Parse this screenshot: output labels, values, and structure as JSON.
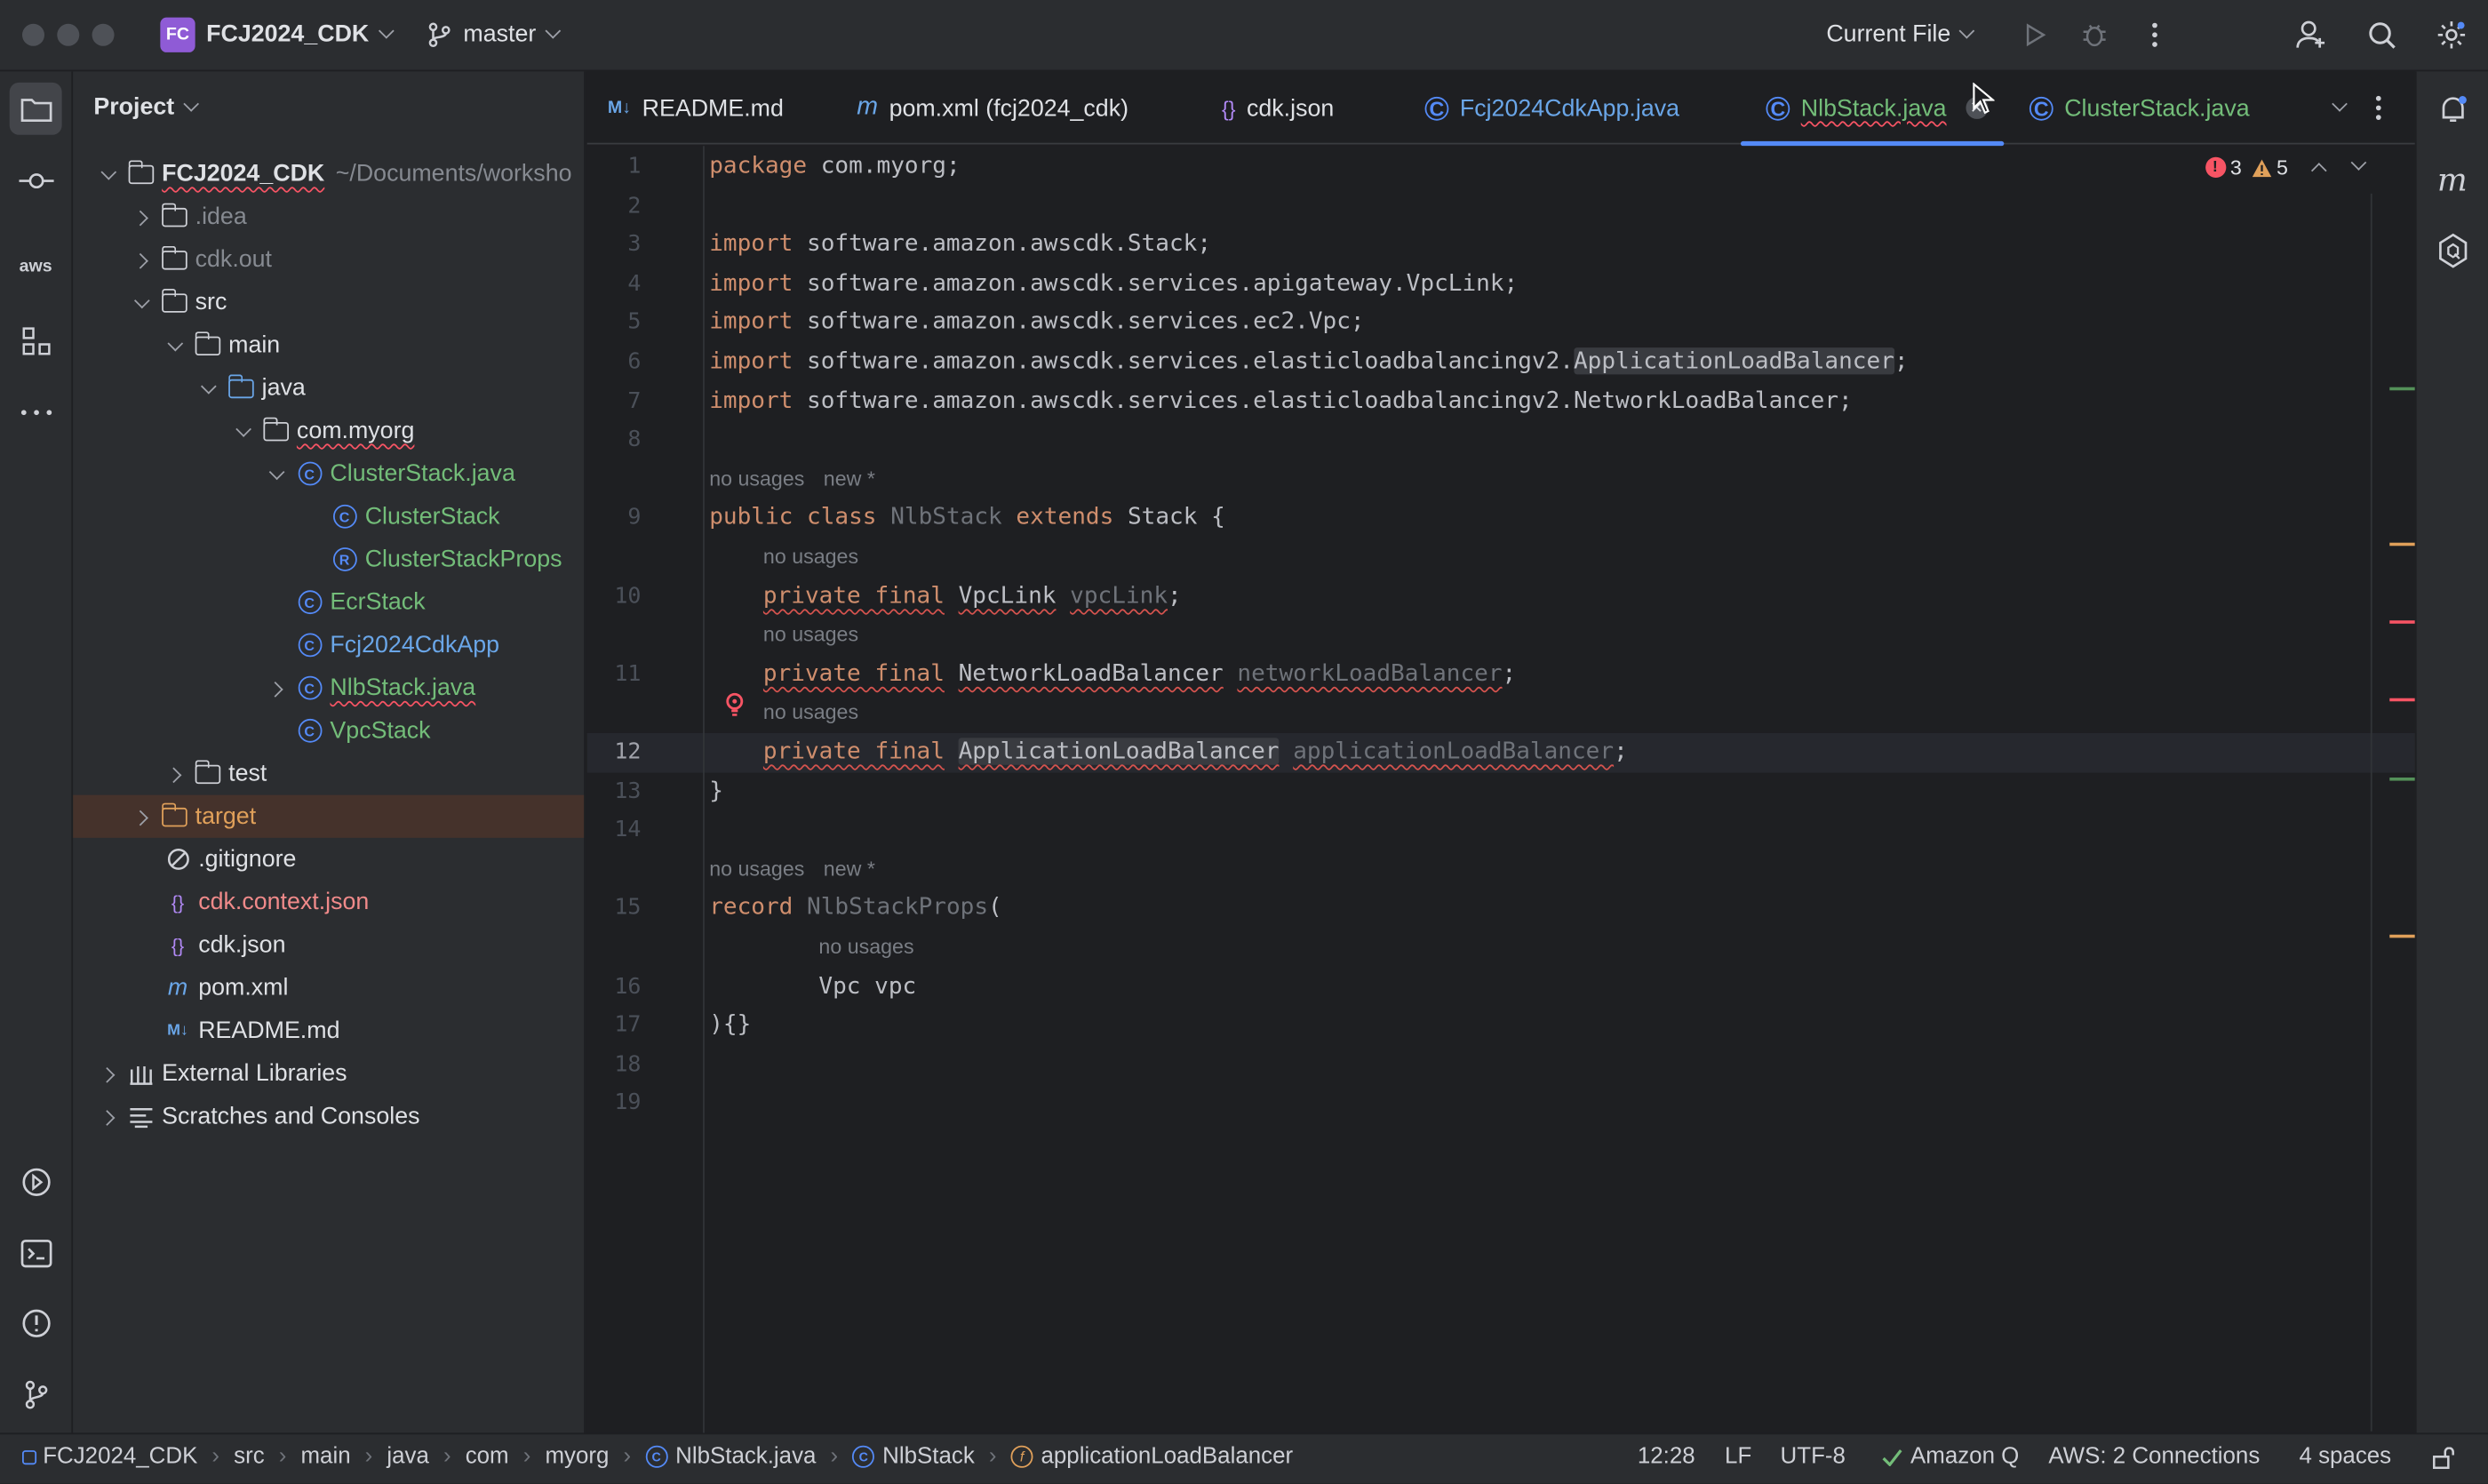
{
  "titlebar": {
    "project_badge": "FC",
    "project_name": "FCJ2024_CDK",
    "branch": "master",
    "run_config": "Current File"
  },
  "project_panel": {
    "header": "Project",
    "root_name": "FCJ2024_CDK",
    "root_path": "~/Documents/worksho",
    "items": [
      {
        "label": ".idea"
      },
      {
        "label": "cdk.out"
      },
      {
        "label": "src"
      },
      {
        "label": "main"
      },
      {
        "label": "java"
      },
      {
        "label": "com.myorg"
      },
      {
        "label": "ClusterStack.java"
      },
      {
        "label": "ClusterStack"
      },
      {
        "label": "ClusterStackProps"
      },
      {
        "label": "EcrStack"
      },
      {
        "label": "Fcj2024CdkApp"
      },
      {
        "label": "NlbStack.java"
      },
      {
        "label": "VpcStack"
      },
      {
        "label": "test"
      },
      {
        "label": "target"
      },
      {
        "label": ".gitignore"
      },
      {
        "label": "cdk.context.json"
      },
      {
        "label": "cdk.json"
      },
      {
        "label": "pom.xml"
      },
      {
        "label": "README.md"
      },
      {
        "label": "External Libraries"
      },
      {
        "label": "Scratches and Consoles"
      }
    ],
    "icon_letters": {
      "class": "C",
      "record": "R",
      "maven": "m",
      "markdown": "M↓"
    }
  },
  "tabs": [
    {
      "label": "README.md",
      "icon": "M↓"
    },
    {
      "label": "pom.xml (fcj2024_cdk)",
      "icon": "m"
    },
    {
      "label": "cdk.json",
      "icon": "{}"
    },
    {
      "label": "Fcj2024CdkApp.java",
      "icon": "C"
    },
    {
      "label": "NlbStack.java",
      "icon": "C"
    },
    {
      "label": "ClusterStack.java",
      "icon": "C"
    }
  ],
  "editor": {
    "line_numbers": [
      "1",
      "2",
      "3",
      "4",
      "5",
      "6",
      "7",
      "8",
      "9",
      "10",
      "11",
      "12",
      "13",
      "14",
      "15",
      "16",
      "17",
      "18",
      "19"
    ],
    "hints": {
      "no_usages": "no usages",
      "new": "new *"
    },
    "errors": "3",
    "warnings": "5",
    "code": {
      "l1_kw": "package",
      "l1": " com.myorg;",
      "l3_kw": "import",
      "l3": " software.amazon.awscdk.Stack;",
      "l4": " software.amazon.awscdk.services.apigateway.VpcLink;",
      "l5": " software.amazon.awscdk.services.ec2.Vpc;",
      "l6": " software.amazon.awscdk.services.elasticloadbalancingv2.",
      "l6_hl": "ApplicationLoadBalancer",
      "l6_end": ";",
      "l7": " software.amazon.awscdk.services.elasticloadbalancingv2.NetworkLoadBalancer;",
      "l9_kw1": "public class",
      "l9_name": "NlbStack",
      "l9_kw2": "extends",
      "l9_rest": " Stack {",
      "private_final": "private final",
      "l10_type": "VpcLink",
      "l10_field": "vpcLink",
      "l11_type": "NetworkLoadBalancer",
      "l11_field": "networkLoadBalancer",
      "l12_type": "ApplicationLoadBalancer",
      "l12_field": "applicationLoadBalancer",
      "semi": ";",
      "l13": "}",
      "l15_kw": "record",
      "l15_name": "NlbStackProps",
      "l15_paren": "(",
      "l16": "Vpc vpc",
      "l17": "){}"
    }
  },
  "statusbar": {
    "crumbs": [
      "FCJ2024_CDK",
      "src",
      "main",
      "java",
      "com",
      "myorg",
      "NlbStack.java",
      "NlbStack",
      "applicationLoadBalancer"
    ],
    "position": "12:28",
    "line_sep": "LF",
    "encoding": "UTF-8",
    "amazon_q": "Amazon Q",
    "aws": "AWS: 2 Connections",
    "indent": "4 spaces"
  },
  "colors": {
    "accent": "#548af7",
    "error": "#f75464",
    "warning": "#e0a05a",
    "vcs_new": "#73bd79"
  }
}
